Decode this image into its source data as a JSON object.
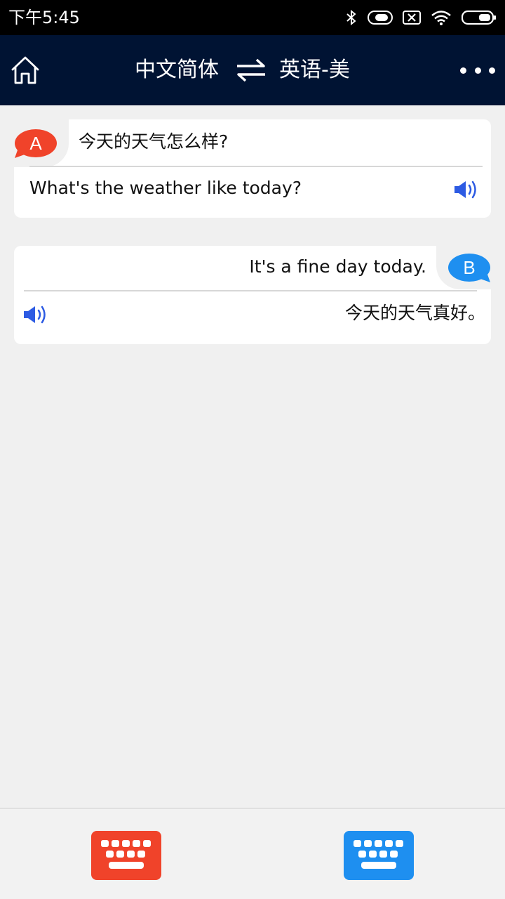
{
  "status_bar": {
    "time": "下午5:45",
    "icons": [
      "bluetooth-icon",
      "toggle-icon",
      "sim-off-icon",
      "wifi-icon",
      "battery-icon"
    ]
  },
  "header": {
    "source_language": "中文简体",
    "target_language": "英语-美",
    "icons": [
      "home-icon",
      "swap-icon",
      "more-icon"
    ]
  },
  "conversation": [
    {
      "speaker": "A",
      "original": "今天的天气怎么样?",
      "translation": "What's the weather like today?",
      "color": "#f0432a"
    },
    {
      "speaker": "B",
      "original": "It's a fine day today.",
      "translation": "今天的天气真好。",
      "color": "#1e8ff0"
    }
  ],
  "colors": {
    "header_bg": "#001333",
    "background": "#f0f0f0",
    "speaker_icon": "#2d5be3"
  },
  "bottom_bar": {
    "keyboard_a_icon": "keyboard-icon",
    "keyboard_b_icon": "keyboard-icon"
  }
}
